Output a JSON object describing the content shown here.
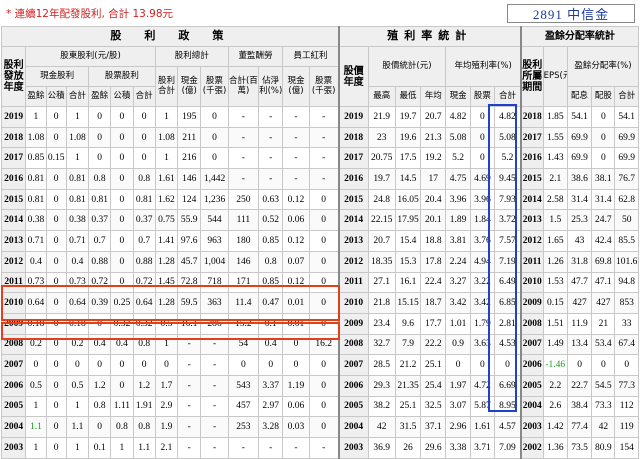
{
  "header": {
    "note": "* 連續12年配發股利, 合計 13.98元",
    "stock_code": "2891 中信金"
  },
  "columns": {
    "group_dividend": "股　利　政　策",
    "group_yield": "殖利率統計",
    "group_payout": "盈餘分配率統計",
    "year_label": "股利發放年度",
    "shareholder_div": "股東股利(元/股)",
    "total_div": "股利總計",
    "director_comp": "董監酬勞",
    "employee_bonus": "員工紅利",
    "cash_div": "現金股利",
    "stock_div": "股票股利",
    "div_total": "股利合計",
    "cash_bil": "現金(億)",
    "stock_k": "股票(千張)",
    "comp_total": "合計(百萬)",
    "net_ratio": "佔淨利(%)",
    "emp_cash": "現金(億)",
    "emp_stock": "股票(千張)",
    "surplus": "盈餘",
    "reserve": "公積",
    "sum": "合計",
    "price_year": "股價年度",
    "price_stats": "股價統計(元)",
    "avg_yield": "年均殖利率(%)",
    "high": "最高",
    "low": "最低",
    "avg": "年均",
    "cash": "現金",
    "stock": "股票",
    "payout_period": "股利所屬期間",
    "eps": "EPS(元)",
    "payout_ratio": "盈餘分配率(%)",
    "payout_cash": "配息",
    "payout_stock": "配股"
  },
  "rows": [
    [
      "2019",
      "1",
      "0",
      "1",
      "0",
      "0",
      "0",
      "1",
      "195",
      "0",
      "-",
      "-",
      "-",
      "-",
      "2019",
      "21.9",
      "19.7",
      "20.7",
      "4.82",
      "0",
      "4.82",
      "2018",
      "1.85",
      "54.1",
      "0",
      "54.1"
    ],
    [
      "2018",
      "1.08",
      "0",
      "1.08",
      "0",
      "0",
      "0",
      "1.08",
      "211",
      "0",
      "-",
      "-",
      "-",
      "-",
      "2018",
      "23",
      "19.6",
      "21.3",
      "5.08",
      "0",
      "5.08",
      "2017",
      "1.55",
      "69.9",
      "0",
      "69.9"
    ],
    [
      "2017",
      "0.85",
      "0.15",
      "1",
      "0",
      "0",
      "0",
      "1",
      "216",
      "0",
      "-",
      "-",
      "-",
      "-",
      "2017",
      "20.75",
      "17.5",
      "19.2",
      "5.2",
      "0",
      "5.2",
      "2016",
      "1.43",
      "69.9",
      "0",
      "69.9"
    ],
    [
      "2016",
      "0.81",
      "0",
      "0.81",
      "0.8",
      "0",
      "0.8",
      "1.61",
      "146",
      "1,442",
      "-",
      "-",
      "-",
      "-",
      "2016",
      "19.7",
      "14.5",
      "17",
      "4.75",
      "4.69",
      "9.45",
      "2015",
      "2.1",
      "38.6",
      "38.1",
      "76.7"
    ],
    [
      "2015",
      "0.81",
      "0",
      "0.81",
      "0.81",
      "0",
      "0.81",
      "1.62",
      "124",
      "1,236",
      "250",
      "0.63",
      "0.12",
      "0",
      "2015",
      "24.8",
      "16.05",
      "20.4",
      "3.96",
      "3.96",
      "7.93",
      "2014",
      "2.58",
      "31.4",
      "31.4",
      "62.8"
    ],
    [
      "2014",
      "0.38",
      "0",
      "0.38",
      "0.37",
      "0",
      "0.37",
      "0.75",
      "55.9",
      "544",
      "111",
      "0.52",
      "0.06",
      "0",
      "2014",
      "22.15",
      "17.95",
      "20.1",
      "1.89",
      "1.84",
      "3.72",
      "2013",
      "1.5",
      "25.3",
      "24.7",
      "50"
    ],
    [
      "2013",
      "0.71",
      "0",
      "0.71",
      "0.7",
      "0",
      "0.7",
      "1.41",
      "97.6",
      "963",
      "180",
      "0.85",
      "0.12",
      "0",
      "2013",
      "20.7",
      "15.4",
      "18.8",
      "3.81",
      "3.76",
      "7.57",
      "2012",
      "1.65",
      "43",
      "42.4",
      "85.5"
    ],
    [
      "2012",
      "0.4",
      "0",
      "0.4",
      "0.88",
      "0",
      "0.88",
      "1.28",
      "45.7",
      "1,004",
      "146",
      "0.8",
      "0.07",
      "0",
      "2012",
      "18.35",
      "15.3",
      "17.8",
      "2.24",
      "4.94",
      "7.19",
      "2011",
      "1.26",
      "31.8",
      "69.8",
      "101.6"
    ],
    [
      "2011",
      "0.73",
      "0",
      "0.73",
      "0.72",
      "0",
      "0.72",
      "1.45",
      "72.8",
      "718",
      "171",
      "0.85",
      "0.12",
      "0",
      "2011",
      "27.1",
      "16.1",
      "22.4",
      "3.27",
      "3.22",
      "6.49",
      "2010",
      "1.53",
      "47.7",
      "47.1",
      "94.8"
    ],
    [
      "2010",
      "0.64",
      "0",
      "0.64",
      "0.39",
      "0.25",
      "0.64",
      "1.28",
      "59.5",
      "363",
      "11.4",
      "0.47",
      "0.01",
      "0",
      "2010",
      "21.8",
      "15.15",
      "18.7",
      "3.42",
      "3.42",
      "6.85",
      "2009",
      "0.15",
      "427",
      "427",
      "853"
    ],
    [
      "2009",
      "0.18",
      "0",
      "0.18",
      "0",
      "0.32",
      "0.32",
      "0.5",
      "16.1",
      "286",
      "15.2",
      "0.1",
      "0.01",
      "0",
      "2009",
      "23.4",
      "9.6",
      "17.7",
      "1.01",
      "1.79",
      "2.81",
      "2008",
      "1.51",
      "11.9",
      "21",
      "33"
    ],
    [
      "2008",
      "0.2",
      "0",
      "0.2",
      "0.4",
      "0.4",
      "0.8",
      "1",
      "-",
      "-",
      "54",
      "0.4",
      "0",
      "16.2",
      "2008",
      "32.7",
      "7.9",
      "22.2",
      "0.9",
      "3.63",
      "4.53",
      "2007",
      "1.49",
      "13.4",
      "53.4",
      "67.4"
    ],
    [
      "2007",
      "0",
      "0",
      "0",
      "0",
      "0",
      "0",
      "0",
      "-",
      "-",
      "0",
      "0",
      "0",
      "0",
      "2007",
      "28.5",
      "21.2",
      "25.1",
      "0",
      "0",
      "0",
      "2006",
      "-1.46",
      "0",
      "0",
      "0"
    ],
    [
      "2006",
      "0.5",
      "0",
      "0.5",
      "1.2",
      "0",
      "1.2",
      "1.7",
      "-",
      "-",
      "543",
      "3.37",
      "1.19",
      "0",
      "2006",
      "29.3",
      "21.35",
      "25.4",
      "1.97",
      "4.72",
      "6.69",
      "2005",
      "2.2",
      "22.7",
      "54.5",
      "77.3"
    ],
    [
      "2005",
      "1",
      "0",
      "1",
      "0.8",
      "1.11",
      "1.91",
      "2.9",
      "-",
      "-",
      "457",
      "2.97",
      "0.06",
      "0",
      "2005",
      "38.2",
      "25.1",
      "32.5",
      "3.07",
      "5.87",
      "8.95",
      "2004",
      "2.6",
      "38.4",
      "73.3",
      "112"
    ],
    [
      "2004",
      "1.1",
      "0",
      "1.1",
      "0",
      "0.8",
      "0.8",
      "1.9",
      "-",
      "-",
      "253",
      "3.28",
      "0.03",
      "0",
      "2004",
      "42",
      "31.5",
      "37.1",
      "2.96",
      "1.61",
      "4.57",
      "2003",
      "1.42",
      "77.4",
      "42",
      "119"
    ],
    [
      "2003",
      "1",
      "0",
      "1",
      "0.1",
      "1",
      "1.1",
      "2.1",
      "-",
      "-",
      "-",
      "-",
      "-",
      "-",
      "2003",
      "36.9",
      "26",
      "29.6",
      "3.38",
      "3.71",
      "7.09",
      "2002",
      "1.36",
      "73.5",
      "80.9",
      "154"
    ]
  ],
  "colors": {
    "note": "#d02020",
    "code": "#1a3aa0",
    "red_box": "#e0401a",
    "blue_box": "#2040d0",
    "negative": "#1a9a1a",
    "header_bg": "#efefef"
  }
}
